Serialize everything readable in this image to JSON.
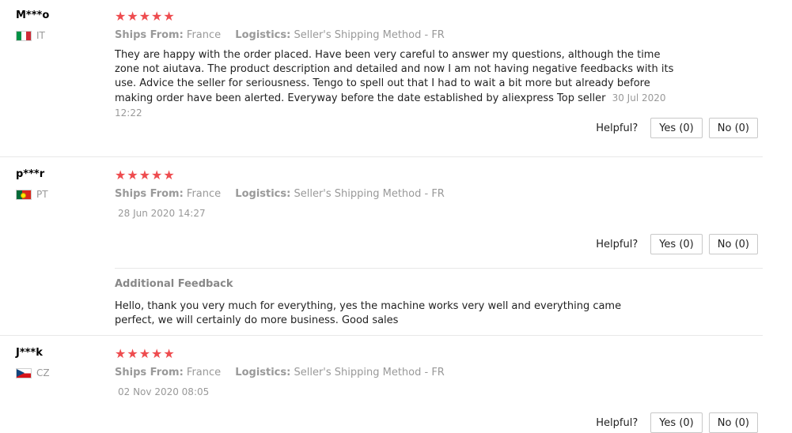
{
  "reviews": [
    {
      "name": "M***o",
      "country": "IT",
      "flag_icon": "flag-italy-icon",
      "stars": "★★★★★",
      "ships_from_label": "Ships From:",
      "ships_from": "France",
      "logistics_label": "Logistics:",
      "logistics": "Seller's Shipping Method - FR",
      "text": "They are happy with the order placed. Have been very careful to answer my questions, although the time zone not aiutava. The product description and detailed and now I am not having negative feedbacks with its use. Advice the seller for seriousness. Tengo to spell out that I had to wait a bit more but already before making order have been alerted. Everyway before the date established by aliexpress Top seller",
      "date": "30 Jul 2020 12:22",
      "helpful_label": "Helpful?",
      "yes_label": "Yes (0)",
      "no_label": "No (0)"
    },
    {
      "name": "p***r",
      "country": "PT",
      "flag_icon": "flag-portugal-icon",
      "stars": "★★★★★",
      "ships_from_label": "Ships From:",
      "ships_from": "France",
      "logistics_label": "Logistics:",
      "logistics": "Seller's Shipping Method - FR",
      "date": "28 Jun 2020 14:27",
      "helpful_label": "Helpful?",
      "yes_label": "Yes (0)",
      "no_label": "No (0)",
      "additional_feedback_title": "Additional Feedback",
      "additional_feedback_text": "Hello, thank you very much for everything, yes the machine works very well and everything came perfect, we will certainly do more business. Good sales"
    },
    {
      "name": "J***k",
      "country": "CZ",
      "flag_icon": "flag-czech-icon",
      "stars": "★★★★★",
      "ships_from_label": "Ships From:",
      "ships_from": "France",
      "logistics_label": "Logistics:",
      "logistics": "Seller's Shipping Method - FR",
      "date": "02 Nov 2020 08:05",
      "helpful_label": "Helpful?",
      "yes_label": "Yes (0)",
      "no_label": "No (0)"
    }
  ],
  "colors": {
    "star": "#ee4c4f",
    "muted": "#999999",
    "divider": "#e8e8e8"
  }
}
